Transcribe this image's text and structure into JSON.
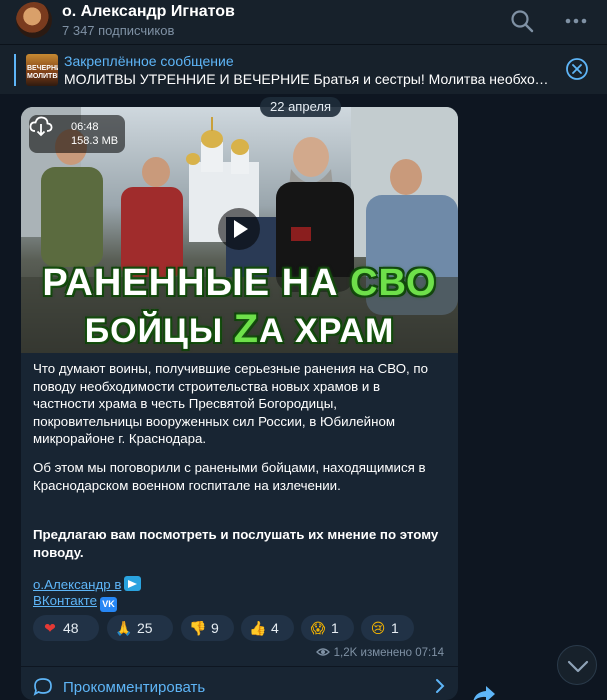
{
  "header": {
    "channel_name": "о. Александр Игнатов",
    "subscribers": "7 347 подписчиков",
    "search_icon": "search-icon",
    "menu_icon": "more-dots-icon"
  },
  "pinned": {
    "title": "Закреплённое сообщение",
    "text": "МОЛИТВЫ УТРЕННИЕ И ВЕЧЕРНИЕ  Братья и сестры!  Молитва необходима…",
    "thumb_text": "ВЕЧЕРНИЕ\nМОЛИТВЫ",
    "close_icon": "close-circle-icon"
  },
  "date_label": "22 апреля",
  "post": {
    "video": {
      "duration": "06:48",
      "size": "158.3 MB",
      "overlay_line1_a": "РАНЕННЫЕ НА ",
      "overlay_line1_b": "СВО",
      "overlay_line2_a": "БОЙЦЫ ",
      "overlay_line2_b": "Z",
      "overlay_line2_c": "А ХРАМ"
    },
    "paragraph1": "Что думают воины, получившие серьезные ранения на СВО, по поводу необходимости строительства новых храмов и в частности храма в честь Пресвятой Богородицы, покровительницы вооруженных сил России, в Юбилейном микрорайоне г. Краснодара.",
    "paragraph2": "Об этом мы поговорили с  ранеными бойцами, находящимися в Краснодарском военном госпитале на излечении.",
    "paragraph3": "Предлагаю вам посмотреть и послушать их мнение по этому поводу.",
    "link1": "о.Александр в",
    "link2": "ВКонтакте",
    "vk_badge": "VK",
    "reactions": [
      {
        "emoji": "❤",
        "count": "48",
        "color": "#e53935"
      },
      {
        "emoji": "🙏",
        "count": "25",
        "color": "#f4b400"
      },
      {
        "emoji": "👎",
        "count": "9",
        "color": "#f4b400"
      },
      {
        "emoji": "👍",
        "count": "4",
        "color": "#f4b400"
      },
      {
        "emoji": "😱",
        "count": "1",
        "color": "#f4b400"
      },
      {
        "emoji": "😢",
        "count": "1",
        "color": "#f4b400"
      }
    ],
    "views": "1,2K",
    "edited_time": "изменено 07:14",
    "comment_label": "Прокомментировать"
  },
  "colors": {
    "background": "#0e1621",
    "panel": "#17212b",
    "bubble": "#182533",
    "accent": "#5eb5f7"
  }
}
